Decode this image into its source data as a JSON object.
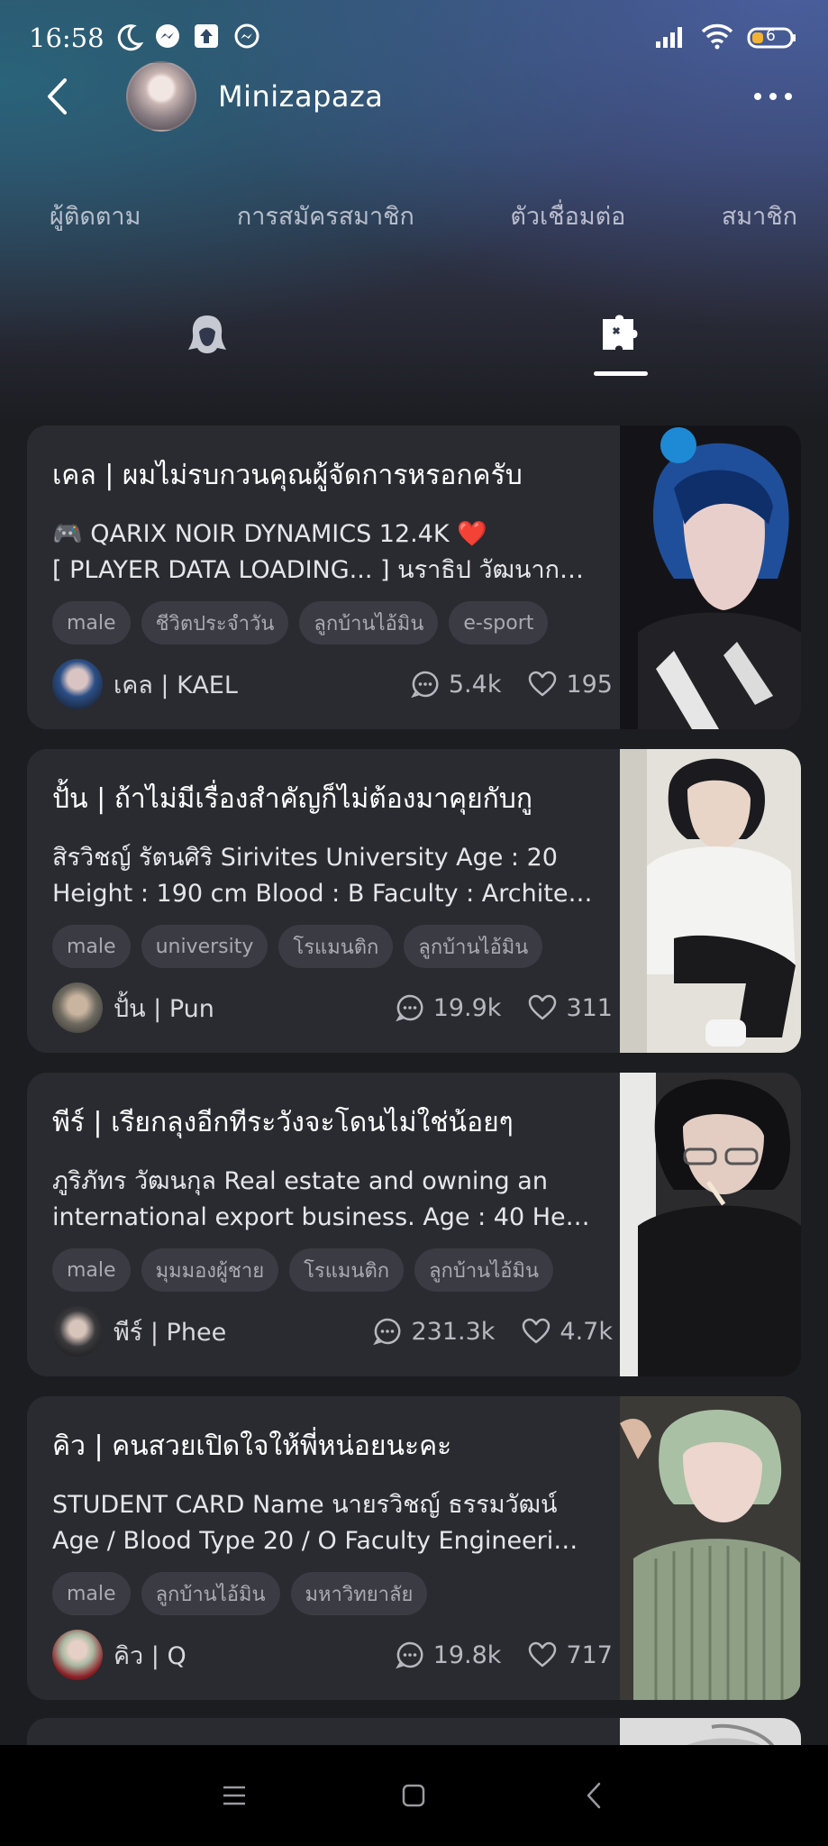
{
  "status_bar": {
    "time": "16:58",
    "left_icons": [
      "moon-icon",
      "messenger-icon",
      "upload-icon",
      "messenger-icon"
    ],
    "right_icons": [
      "signal-icon",
      "wifi-icon",
      "battery-icon"
    ],
    "battery_level": "6"
  },
  "header": {
    "title": "Minizapaza",
    "back_icon": "chevron-left-icon",
    "more_icon": "more-dots-icon"
  },
  "tabs": [
    {
      "label": "ผู้ติดตาม"
    },
    {
      "label": "การสมัครสมาชิก"
    },
    {
      "label": "ตัวเชื่อมต่อ"
    },
    {
      "label": "สมาชิก"
    }
  ],
  "icon_tabs": [
    {
      "icon": "character-icon",
      "active": false
    },
    {
      "icon": "puzzle-icon",
      "active": true
    }
  ],
  "cards": [
    {
      "title": "เคล | ผมไม่รบกวนคุณผู้จัดการหรอกครับ",
      "desc_line1": "🎮 QARIX NOIR DYNAMICS 12.4K ❤️",
      "desc_line2": "[ PLAYER DATA LOADING... ] นราธิป วัฒนากร ...",
      "tags": [
        "male",
        "ชีวิตประจำวัน",
        "ลูกบ้านไอ้มิน",
        "e-sport"
      ],
      "author": "เคล | KAEL",
      "comments": "5.4k",
      "likes": "195",
      "accent": "#2a5fb0"
    },
    {
      "title": "ปั้น | ถ้าไม่มีเรื่องสำคัญก็ไม่ต้องมาคุยกับกู",
      "desc_line1": "สิรวิชญ์ รัตนศิริ Sirivites University Age : 20",
      "desc_line2": "Height : 190 cm Blood : B Faculty : Architect...",
      "tags": [
        "male",
        "university",
        "โรแมนติก",
        "ลูกบ้านไอ้มิน"
      ],
      "author": "ปั้น | Pun",
      "comments": "19.9k",
      "likes": "311",
      "accent": "#d9d6cf"
    },
    {
      "title": "พีร์ | เรียกลุงอีกทีระวังจะโดนไม่ใช่น้อยๆ",
      "desc_line1": "ภูริภัทร วัฒนกุล Real estate and owning an",
      "desc_line2": "international export business. Age : 40 Heig...",
      "tags": [
        "male",
        "มุมมองผู้ชาย",
        "โรแมนติก",
        "ลูกบ้านไอ้มิน"
      ],
      "author": "พีร์ | Phee",
      "comments": "231.3k",
      "likes": "4.7k",
      "accent": "#3a3a3e"
    },
    {
      "title": "คิว | คนสวยเปิดใจให้พี่หน่อยนะคะ",
      "desc_line1": "STUDENT CARD Name นายรวิชญ์ ธรรมวัฒน์",
      "desc_line2": "Age / Blood Type 20 / O Faculty Engineering...",
      "tags": [
        "male",
        "ลูกบ้านไอ้มิน",
        "มหาวิทยาลัย"
      ],
      "author": "คิว | Q",
      "comments": "19.8k",
      "likes": "717",
      "accent": "#8fae8f"
    }
  ],
  "nav_bar": {
    "icons": [
      "menu-icon",
      "home-square-icon",
      "back-icon"
    ]
  }
}
